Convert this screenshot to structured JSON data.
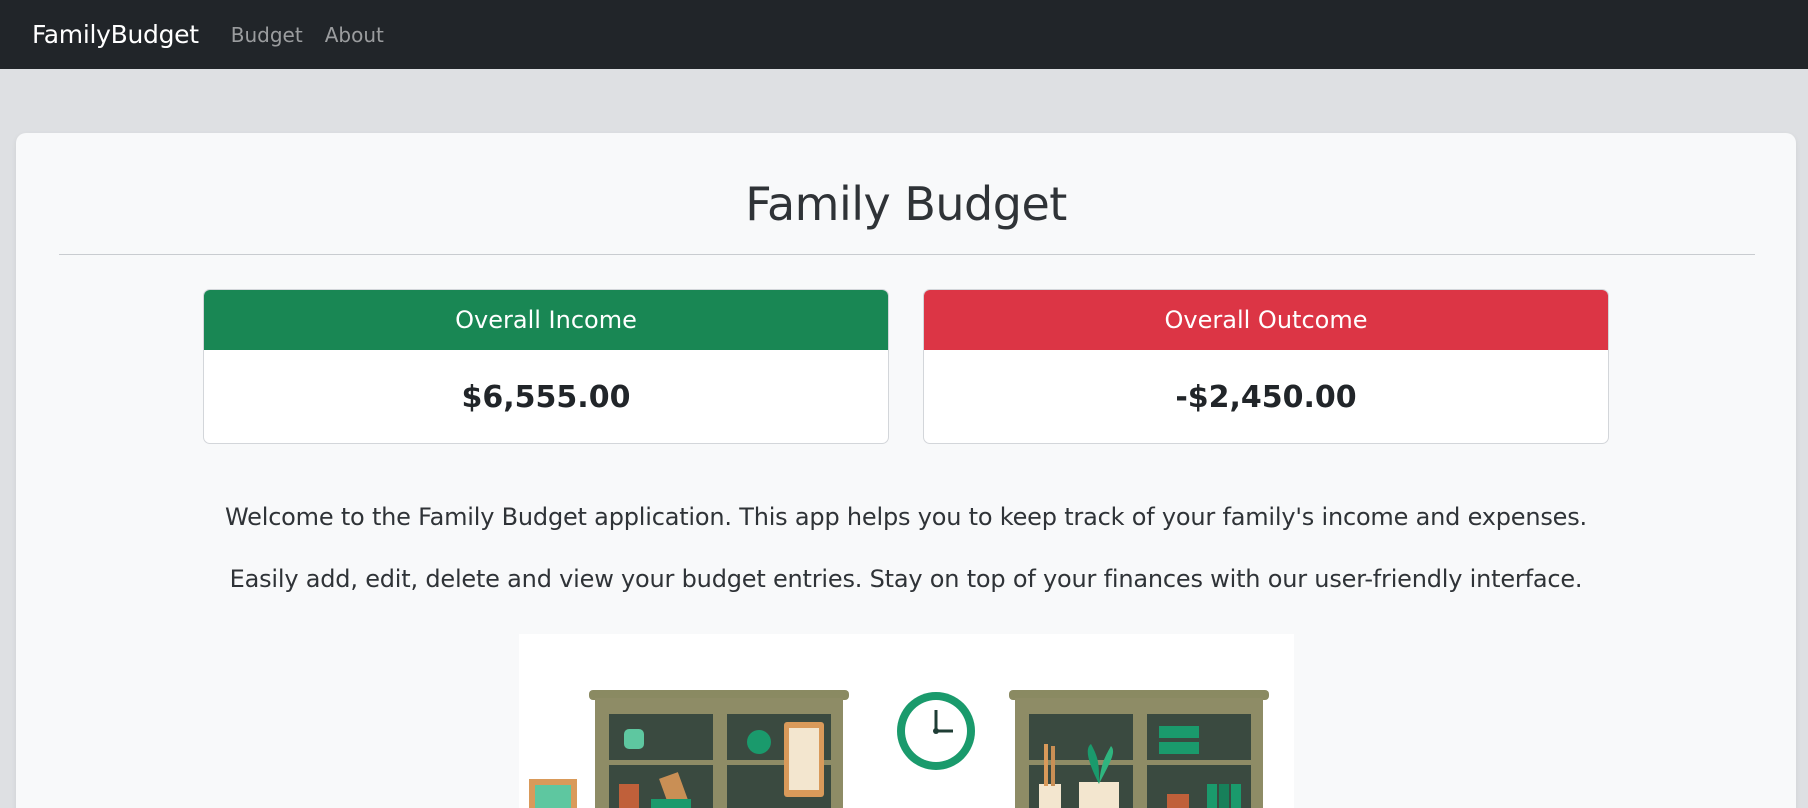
{
  "navbar": {
    "brand": "FamilyBudget",
    "links": [
      {
        "label": "Budget"
      },
      {
        "label": "About"
      }
    ]
  },
  "main": {
    "title": "Family Budget",
    "income": {
      "label": "Overall Income",
      "value": "$6,555.00",
      "color": "#198754"
    },
    "outcome": {
      "label": "Overall Outcome",
      "value": "-$2,450.00",
      "color": "#dc3545"
    },
    "intro": [
      "Welcome to the Family Budget application. This app helps you to keep track of your family's income and expenses.",
      "Easily add, edit, delete and view your budget entries. Stay on top of your finances with our user-friendly interface."
    ],
    "illustration": {
      "icons": [
        "cabinet-icon",
        "clock-icon",
        "cabinet-icon",
        "plant-icon",
        "picture-frame-icon"
      ]
    }
  },
  "colors": {
    "navbar_bg": "#212529",
    "page_bg": "#dee0e3",
    "card_bg": "#f8f9fa",
    "cabinet": "#8a8a62",
    "accent_green": "#1a9a6c"
  }
}
